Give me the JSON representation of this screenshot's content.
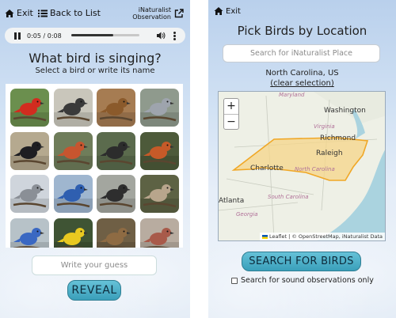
{
  "left_panel": {
    "exit_label": "Exit",
    "back_label": "Back to List",
    "inat_line1": "iNaturalist",
    "inat_line2": "Observation",
    "player": {
      "time": "0:05 / 0:08",
      "progress": 0.62
    },
    "heading": "What bird is singing?",
    "subheading": "Select a bird or write its name",
    "guess_placeholder": "Write your guess",
    "reveal_label": "REVEAL",
    "birds": [
      {
        "name": "cardinal",
        "bg": "#6b8f4e",
        "body": "#d22c1f"
      },
      {
        "name": "chickadee",
        "bg": "#c9c6bb",
        "body": "#3a3a3a"
      },
      {
        "name": "wren",
        "bg": "#a67c52",
        "body": "#8b5a2b"
      },
      {
        "name": "titmouse",
        "bg": "#8f9a8d",
        "body": "#9ea4ad"
      },
      {
        "name": "grackle",
        "bg": "#b5a98f",
        "body": "#1e1e22"
      },
      {
        "name": "woodpecker",
        "bg": "#6f7d5a",
        "body": "#c7552f"
      },
      {
        "name": "towhee",
        "bg": "#5b6b4d",
        "body": "#2c2c2c"
      },
      {
        "name": "robin",
        "bg": "#4d5a3a",
        "body": "#c65a28"
      },
      {
        "name": "mockingbird",
        "bg": "#cfd5dc",
        "body": "#8a8f96"
      },
      {
        "name": "blue-jay",
        "bg": "#9fb6cf",
        "body": "#2f5fb0"
      },
      {
        "name": "downy-woodpecker",
        "bg": "#a3a69f",
        "body": "#2e2e2e"
      },
      {
        "name": "mourning-dove",
        "bg": "#5d6244",
        "body": "#b8a58c"
      },
      {
        "name": "bluebird",
        "bg": "#b7c2c8",
        "body": "#3a68c2"
      },
      {
        "name": "goldfinch",
        "bg": "#3f5434",
        "body": "#e9c920"
      },
      {
        "name": "sparrow",
        "bg": "#6f5f45",
        "body": "#8e6b43"
      },
      {
        "name": "house-finch",
        "bg": "#b8aca0",
        "body": "#a85a4a"
      }
    ]
  },
  "right_panel": {
    "exit_label": "Exit",
    "title": "Pick Birds by Location",
    "search_placeholder": "Search for iNaturalist Place",
    "location": "North Carolina, US",
    "clear_label": "(clear selection)",
    "map": {
      "zoom_in": "+",
      "zoom_out": "−",
      "labels": {
        "washington": "Washington",
        "maryland": "Maryland",
        "virginia": "Virginia",
        "richmond": "Richmond",
        "raleigh": "Raleigh",
        "charlotte": "Charlotte",
        "north_carolina": "North Carolina",
        "south_carolina": "South Carolina",
        "atlanta": "Atlanta",
        "georgia": "Georgia"
      },
      "attribution_leaflet": "Leaflet",
      "attribution_rest": "| © OpenStreetMap, iNaturalist Data"
    },
    "search_button": "SEARCH FOR BIRDS",
    "sound_only_label": "Search for sound observations only"
  }
}
